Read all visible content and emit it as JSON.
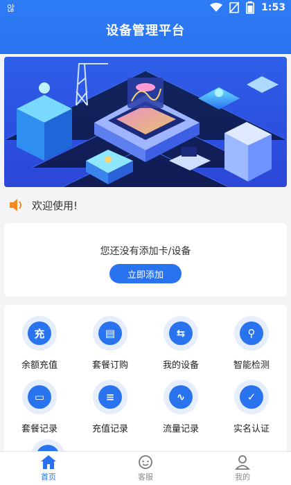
{
  "status_bar": {
    "carrier": "않",
    "time": "1:53"
  },
  "header": {
    "title": "设备管理平台"
  },
  "banner": {
    "slide_count": 1,
    "active_slide": 1
  },
  "notice": {
    "text": "欢迎使用!"
  },
  "empty_state": {
    "message": "您还没有添加卡/设备",
    "add_button": "立即添加"
  },
  "menu": {
    "items": [
      {
        "label": "余额充值",
        "icon": "recharge-icon",
        "glyph": "充"
      },
      {
        "label": "套餐订购",
        "icon": "package-order-icon",
        "glyph": "▤"
      },
      {
        "label": "我的设备",
        "icon": "swap-device-icon",
        "glyph": "⇆"
      },
      {
        "label": "智能检测",
        "icon": "search-icon",
        "glyph": "⚲"
      },
      {
        "label": "套餐记录",
        "icon": "package-record-icon",
        "glyph": "▭"
      },
      {
        "label": "充值记录",
        "icon": "list-icon",
        "glyph": "≡"
      },
      {
        "label": "流量记录",
        "icon": "pulse-icon",
        "glyph": "∿"
      },
      {
        "label": "实名认证",
        "icon": "verify-user-icon",
        "glyph": "✓"
      }
    ]
  },
  "bottom_nav": {
    "items": [
      {
        "label": "首页",
        "active": true
      },
      {
        "label": "客服",
        "active": false
      },
      {
        "label": "我的",
        "active": false
      }
    ]
  },
  "colors": {
    "primary": "#2a73ee",
    "icon_bg": "#e6eefc",
    "page_bg": "#f3f4f6"
  }
}
